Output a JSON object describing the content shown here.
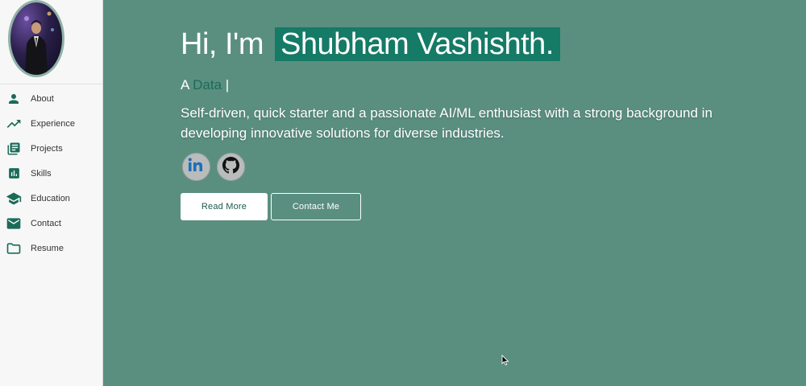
{
  "sidebar": {
    "items": [
      {
        "label": "About",
        "icon": "person-icon"
      },
      {
        "label": "Experience",
        "icon": "trending-up-icon"
      },
      {
        "label": "Projects",
        "icon": "library-books-icon"
      },
      {
        "label": "Skills",
        "icon": "bar-chart-icon"
      },
      {
        "label": "Education",
        "icon": "graduation-cap-icon"
      },
      {
        "label": "Contact",
        "icon": "mail-icon"
      },
      {
        "label": "Resume",
        "icon": "folder-icon"
      }
    ]
  },
  "hero": {
    "greeting_prefix": "Hi, I'm",
    "name": "Shubham Vashishth.",
    "role_prefix": "A",
    "role_word": "Data",
    "role_cursor": "|",
    "bio": "Self-driven, quick starter and a passionate AI/ML enthusiast with a strong background in developing innovative solutions for diverse industries."
  },
  "socials": [
    {
      "icon": "linkedin-icon"
    },
    {
      "icon": "github-icon"
    }
  ],
  "actions": {
    "read_more": "Read More",
    "contact_me": "Contact Me"
  },
  "colors": {
    "background": "#5a8f80",
    "accent": "#157a66",
    "sidebar_icon": "#1b6b58"
  }
}
